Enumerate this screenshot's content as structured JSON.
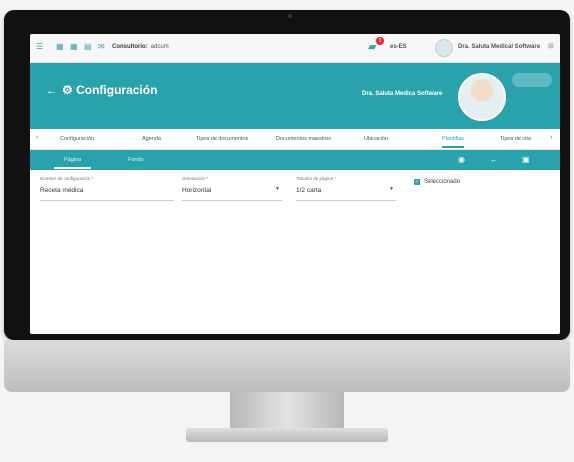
{
  "topbar": {
    "consultorio_label": "Consultorio:",
    "consultorio_value": "adcum",
    "notif_count": "3",
    "lang": "es-ES",
    "user": "Dra. Saluta Medical Software"
  },
  "header": {
    "title": "Configuración",
    "user_name": "Dra. Saluta Medica Software"
  },
  "tabs": [
    "Configuración",
    "Agenda",
    "Tipos de documentos",
    "Documentos maestros",
    "Ubicación",
    "Plantillas",
    "Tipos de cita"
  ],
  "subtabs": [
    "Página",
    "Fondo"
  ],
  "form": {
    "name_label": "Nombre de configuración *",
    "name_value": "Receta médica",
    "orientation_label": "Orientación *",
    "orientation_value": "Horizontal",
    "size_label": "Tamaño de página *",
    "size_value": "1/2 carta",
    "selected_label": "Seleccionado"
  },
  "colors": {
    "accent": "#2aa2ac"
  }
}
